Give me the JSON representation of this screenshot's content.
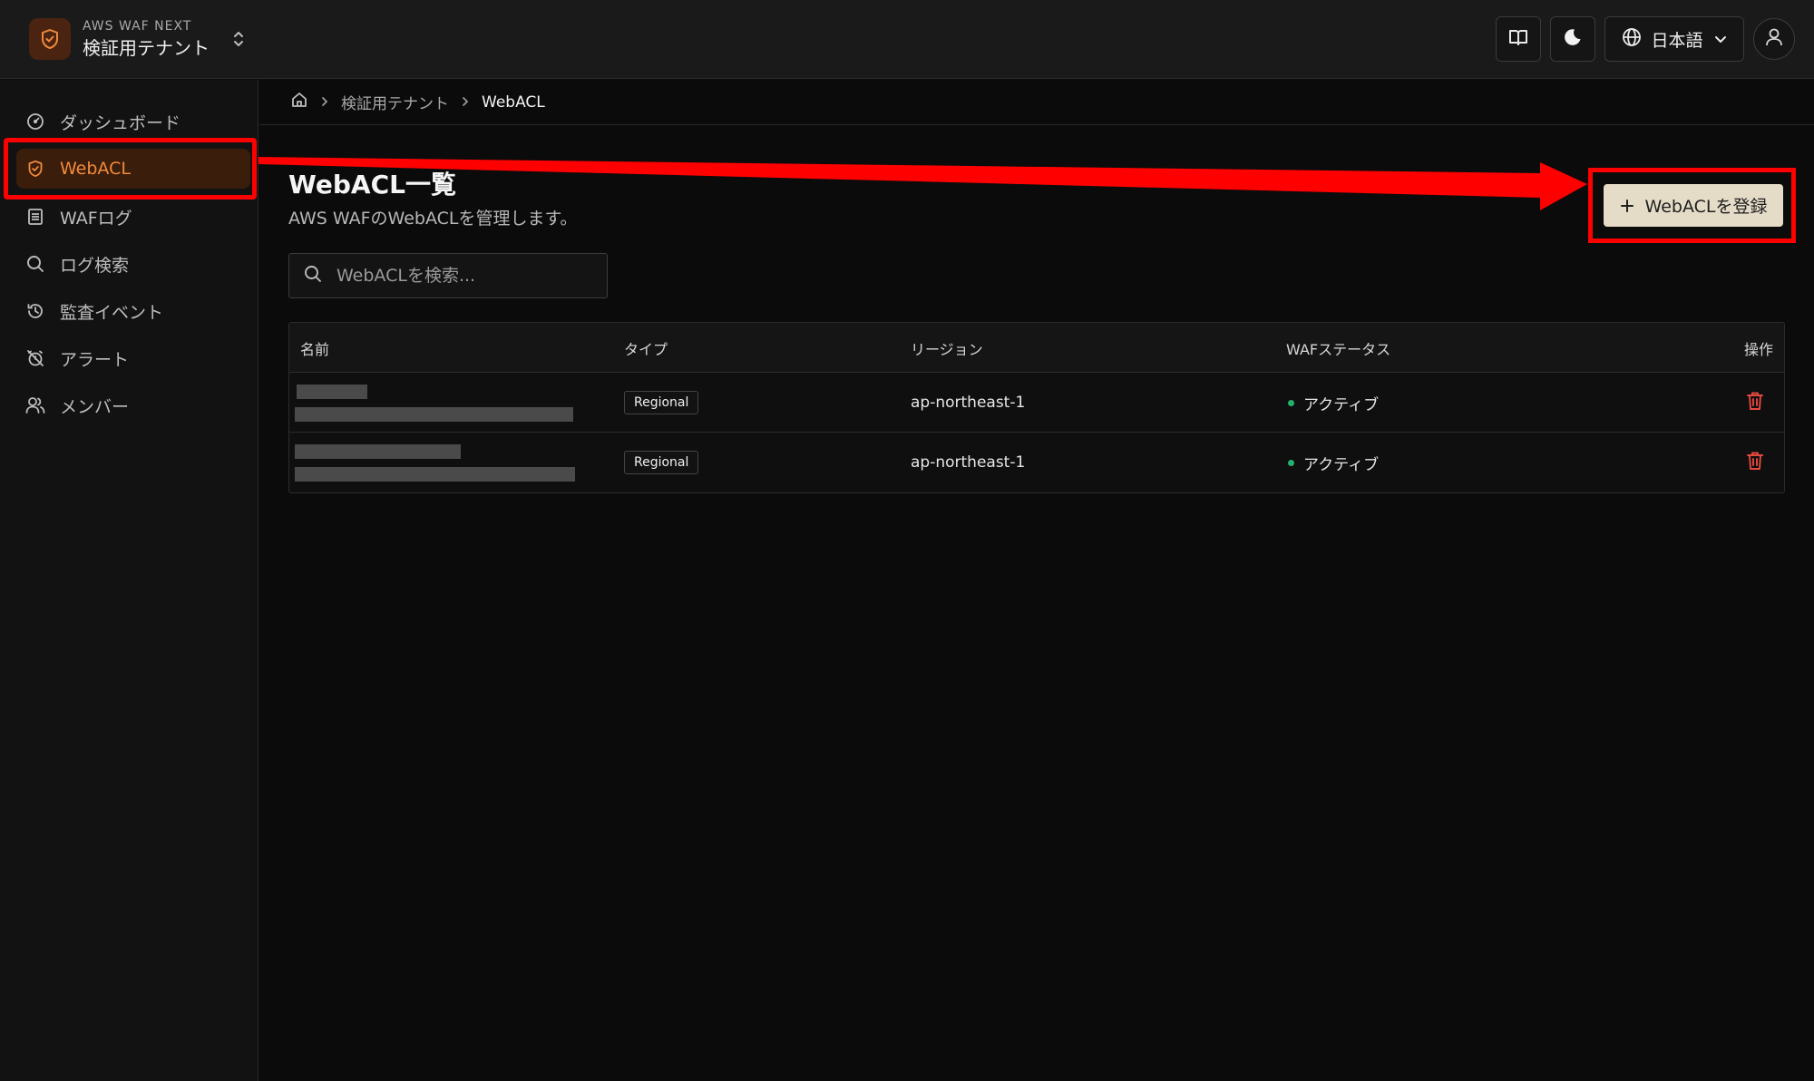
{
  "header": {
    "brand_sub": "AWS WAF NEXT",
    "brand_title": "検証用テナント",
    "language_label": "日本語"
  },
  "sidebar": {
    "items": [
      {
        "label": "ダッシュボード",
        "icon": "gauge-icon"
      },
      {
        "label": "WebACL",
        "icon": "shield-icon",
        "active": true
      },
      {
        "label": "WAFログ",
        "icon": "log-icon"
      },
      {
        "label": "ログ検索",
        "icon": "search-icon"
      },
      {
        "label": "監査イベント",
        "icon": "history-icon"
      },
      {
        "label": "アラート",
        "icon": "alarm-off-icon"
      },
      {
        "label": "メンバー",
        "icon": "users-icon"
      }
    ]
  },
  "breadcrumb": {
    "tenant": "検証用テナント",
    "current": "WebACL"
  },
  "main": {
    "title": "WebACL一覧",
    "description": "AWS WAFのWebACLを管理します。",
    "add_button_label": "WebACLを登録",
    "search_placeholder": "WebACLを検索..."
  },
  "table": {
    "columns": [
      "名前",
      "タイプ",
      "リージョン",
      "WAFステータス",
      "操作"
    ],
    "rows": [
      {
        "type": "Regional",
        "region": "ap-northeast-1",
        "status": "アクティブ"
      },
      {
        "type": "Regional",
        "region": "ap-northeast-1",
        "status": "アクティブ"
      }
    ]
  },
  "colors": {
    "accent": "#f28a3c",
    "active_bg": "#3b1d0b",
    "status_active": "#23b26d",
    "delete": "#e5483f",
    "annotation": "#ff0000",
    "primary_button": "#e5dcc8"
  }
}
